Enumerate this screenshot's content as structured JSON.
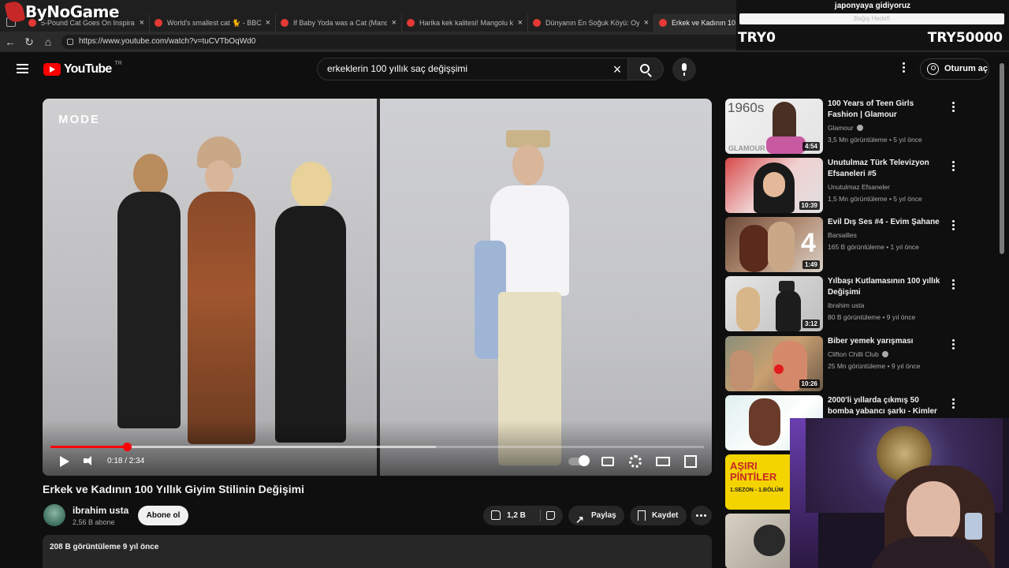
{
  "overlay": {
    "brand": "ByNoGame"
  },
  "browser": {
    "tabs": [
      {
        "label": "5-Pound Cat Goes On Inspiratio"
      },
      {
        "label": "World's smallest cat 🐈 - BBC - Yo"
      },
      {
        "label": "If Baby Yoda was a Cat (Mandalor"
      },
      {
        "label": "Harika kek kalitesi! Mangolu köpe"
      },
      {
        "label": "Dünyanın En Soğuk Köyü: Oymya"
      },
      {
        "label": "Erkek ve Kadının 100 Yıllık Giyim"
      }
    ],
    "url": "https://www.youtube.com/watch?v=tuCVTbOqWd0"
  },
  "stream_overlay": {
    "goal_text": "japonyaya gidiyoruz",
    "bar_text": "Bağış Hedefi",
    "left_value": "TRY0",
    "right_value": "TRY50000"
  },
  "youtube": {
    "logo_text": "YouTube",
    "region": "TR",
    "search_query": "erkeklerin 100 yıllık saç değişşimi",
    "sign_in": "Oturum aç"
  },
  "player": {
    "watermark": "MODE",
    "current_time": "0:18",
    "duration": "2:34",
    "time_display": "0:18 / 2:34",
    "progress_fraction": 0.117,
    "buffer_fraction": 0.59
  },
  "video": {
    "title": "Erkek ve Kadının 100 Yıllık Giyim Stilinin Değişimi",
    "channel": "ibrahim usta",
    "subscribers": "2,56 B abone",
    "subscribe_label": "Abone ol",
    "likes": "1,2 B",
    "share_label": "Paylaş",
    "save_label": "Kaydet",
    "views_line": "208 B görüntüleme  9 yıl önce"
  },
  "recommendations": [
    {
      "title": "100 Years of Teen Girls Fashion | Glamour",
      "channel": "Glamour",
      "verified": true,
      "meta": "3,5 Mn görüntüleme • 5 yıl önce",
      "duration": "4:54",
      "thumb_text": "1960s",
      "thumb_caption": "GLAMOUR"
    },
    {
      "title": "Unutulmaz Türk Televizyon Efsaneleri #5",
      "channel": "Unutulmaz Efsaneler",
      "verified": false,
      "meta": "1,5 Mn görüntüleme • 5 yıl önce",
      "duration": "10:39"
    },
    {
      "title": "Evil Dış Ses #4 - Evim Şahane",
      "channel": "Barsailles",
      "verified": false,
      "meta": "165 B görüntüleme • 1 yıl önce",
      "duration": "1:49",
      "thumb_text": "4"
    },
    {
      "title": "Yılbaşı Kutlamasının 100 yıllık Değişimi",
      "channel": "ibrahim usta",
      "verified": false,
      "meta": "80 B görüntüleme • 9 yıl önce",
      "duration": "3:12"
    },
    {
      "title": "Biber yemek yarışması",
      "channel": "Clifton Chilli Club",
      "verified": true,
      "meta": "25 Mn görüntüleme • 9 yıl önce",
      "duration": "10:26"
    },
    {
      "title": "2000'li yıllarda çıkmış 50 bomba yabancı şarkı - Kimler var ...",
      "channel": "",
      "verified": false,
      "meta": "",
      "duration": ""
    },
    {
      "title": "",
      "channel": "",
      "verified": false,
      "meta": "",
      "duration": "",
      "thumb_text": "AŞIRI PİNTİLER",
      "thumb_caption": "1.SEZON - 1.BÖLÜM"
    },
    {
      "title": "",
      "channel": "",
      "verified": false,
      "meta": "",
      "duration": ""
    }
  ],
  "colors": {
    "accent": "#ff0000",
    "background": "#0f0f0f",
    "pill": "#272727"
  }
}
